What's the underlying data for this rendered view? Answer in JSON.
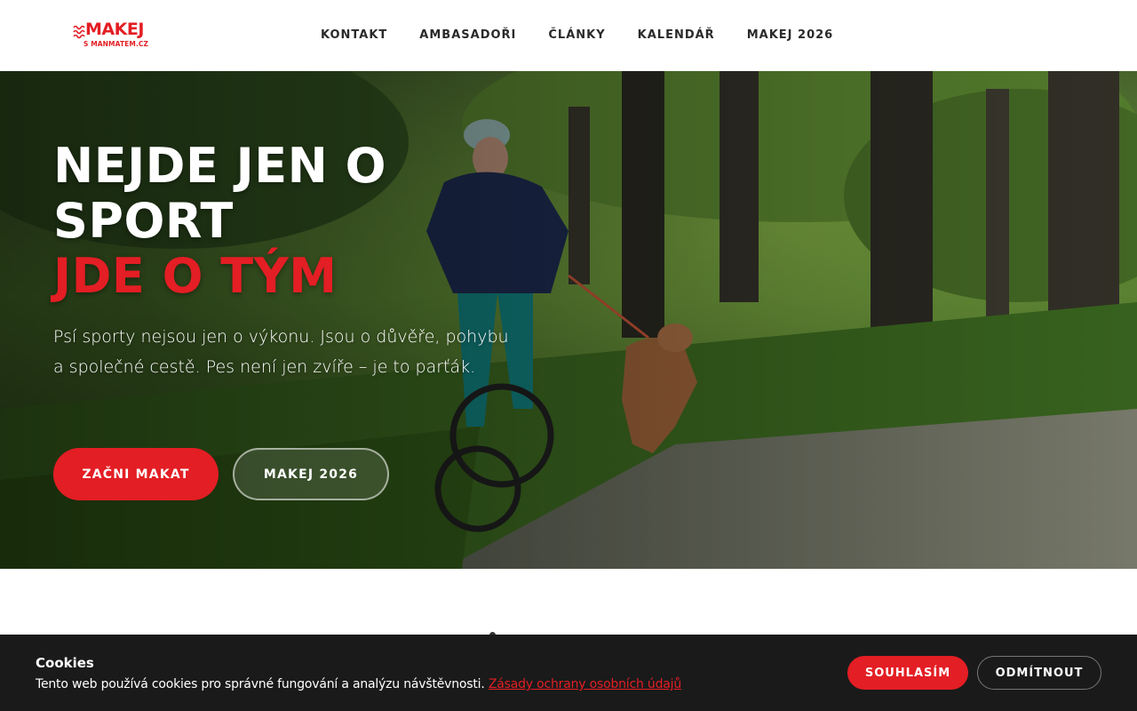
{
  "header": {
    "logo": {
      "brand": "MAKEJ",
      "sub": "S MANMATEM.CZ"
    },
    "nav": [
      "KONTAKT",
      "AMBASADOŘI",
      "ČLÁNKY",
      "KALENDÁŘ",
      "MAKEJ 2026"
    ]
  },
  "hero": {
    "headline_line1": "NEJDE JEN O",
    "headline_line2": "SPORT",
    "headline_line3": "JDE O TÝM",
    "lead": "Psí sporty nejsou jen o výkonu. Jsou o důvěře, pohybu a společné cestě. Pes není jen zvíře – je to parťák.",
    "primary_button": "ZAČNI MAKAT",
    "secondary_button": "MAKEJ 2026"
  },
  "cookie": {
    "title": "Cookies",
    "text": "Tento web používá cookies pro správné fungování a analýzu návštěvnosti.",
    "link": "Zásady ochrany osobních údajů",
    "accept": "SOUHLASÍM",
    "decline": "ODMÍTNOUT"
  },
  "colors": {
    "accent": "#e31e24",
    "cookie_bg": "#1a1a1a",
    "nav_text": "#2a2a2a"
  },
  "icons": {
    "logo_mark": "wave-lines-icon"
  }
}
